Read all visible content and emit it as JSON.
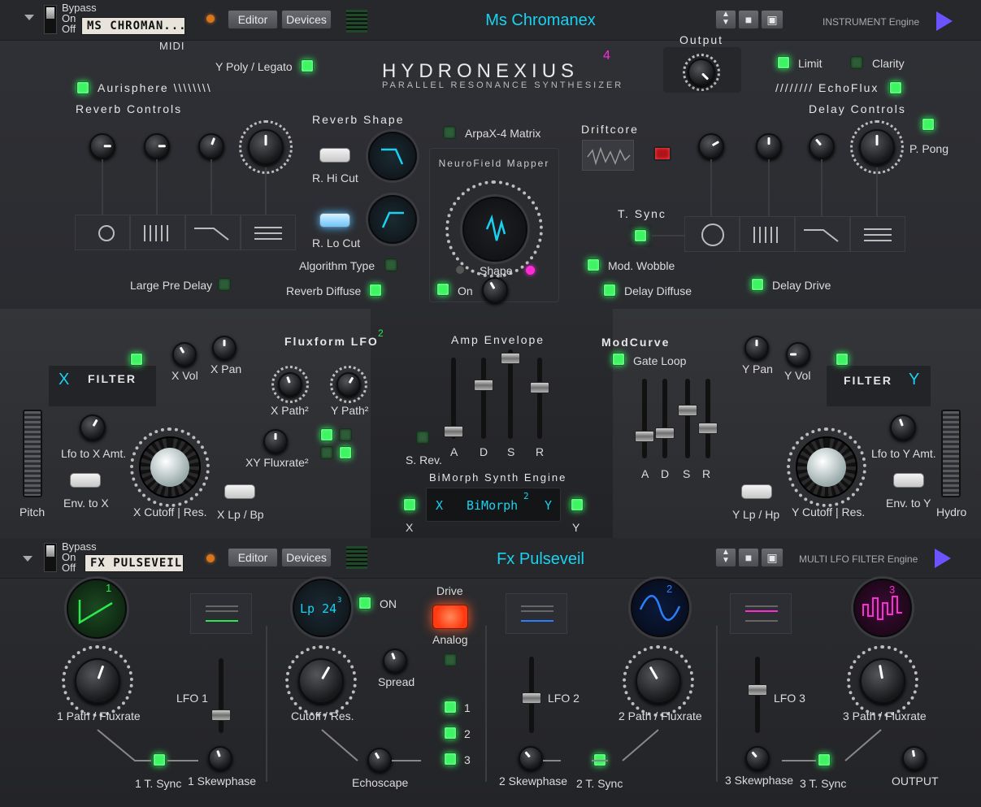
{
  "top": {
    "bypass": {
      "title": "Bypass",
      "on": "On",
      "off": "Off"
    },
    "preset_name": "MS CHROMAN...",
    "midi": "MIDI",
    "editor": "Editor",
    "devices": "Devices",
    "title": "Ms Chromanex",
    "engine": "INSTRUMENT Engine",
    "output": "Output",
    "logo": "HYDRONEXIUS",
    "logo_sup": "4",
    "subtitle": "PARALLEL RESONANCE SYNTHESIZER",
    "poly": "Y Poly / Legato",
    "limit": "Limit",
    "clarity": "Clarity",
    "aurisphere": "Aurisphere \\\\\\\\\\\\\\\\",
    "echoflux": "//////// EchoFlux",
    "reverb_controls": "Reverb Controls",
    "delay_controls": "Delay Controls",
    "reverb_shape": "Reverb Shape",
    "r_hi_cut": "R. Hi Cut",
    "r_lo_cut": "R. Lo Cut",
    "arpax": "ArpaX-4 Matrix",
    "neurofield": "NeuroField Mapper",
    "shape": "Shape",
    "on": "On",
    "driftcore": "Driftcore",
    "p_pong": "P. Pong",
    "t_sync": "T. Sync",
    "mod_wobble": "Mod. Wobble",
    "algorithm_type": "Algorithm Type",
    "large_pre_delay": "Large Pre Delay",
    "reverb_diffuse": "Reverb Diffuse",
    "delay_diffuse": "Delay Diffuse",
    "delay_drive": "Delay Drive"
  },
  "mid": {
    "x_filter": "FILTER",
    "y_filter": "FILTER",
    "x_glyph": "X",
    "y_glyph": "Y",
    "x_vol": "X Vol",
    "x_pan": "X Pan",
    "fluxform": "Fluxform LFO",
    "fluxform_sup": "2",
    "x_path": "X Path²",
    "y_path": "Y Path²",
    "xy_fluxrate": "XY Fluxrate²",
    "lfo_x": "Lfo to X Amt.",
    "env_x": "Env. to X",
    "x_cutoff": "X Cutoff | Res.",
    "x_lp_bp": "X Lp / Bp",
    "pitch": "Pitch",
    "amp_env": "Amp Envelope",
    "s_rev": "S. Rev.",
    "adsr": [
      "A",
      "D",
      "S",
      "R"
    ],
    "bimorph_engine": "BiMorph Synth Engine",
    "bimorph": "BiMorph",
    "bimorph_sup": "2",
    "x": "X",
    "y": "Y",
    "modcurve": "ModCurve",
    "gate_loop": "Gate Loop",
    "y_pan": "Y Pan",
    "y_vol": "Y Vol",
    "lfo_y": "Lfo to Y Amt.",
    "env_y": "Env. to Y",
    "y_cutoff": "Y Cutoff | Res.",
    "y_lp_hp": "Y Lp / Hp",
    "hydro": "Hydro"
  },
  "bot": {
    "bypass": {
      "title": "Bypass",
      "on": "On",
      "off": "Off"
    },
    "preset_name": "FX PULSEVEIL",
    "editor": "Editor",
    "devices": "Devices",
    "title": "Fx Pulseveil",
    "engine": "MULTI  LFO FILTER Engine",
    "lfo1_num": "1",
    "lfo2_num": "2",
    "lfo3_num": "3",
    "path1": "1 Path / Fluxrate",
    "path2": "2 Path / Fluxrate",
    "path3": "3 Path / Fluxrate",
    "lfo1": "LFO 1",
    "lfo2": "LFO 2",
    "lfo3": "LFO 3",
    "tsync1": "1 T. Sync",
    "tsync2": "2 T. Sync",
    "tsync3": "3 T. Sync",
    "skew1": "1 Skewphase",
    "skew2": "2 Skewphase",
    "skew3": "3 Skewphase",
    "filter_disp": "Lp 24",
    "filter_sup": "3",
    "on": "ON",
    "spread": "Spread",
    "cutoff": "Cutoff / Res.",
    "echoscape": "Echoscape",
    "drive": "Drive",
    "analog": "Analog",
    "sel": [
      "1",
      "2",
      "3"
    ],
    "output": "OUTPUT"
  },
  "colors": {
    "led": "#3df562",
    "cyan": "#19d2f0",
    "magenta": "#ff2bd6",
    "green": "#2ee84f",
    "blue": "#2a7fff",
    "drive": "#ff5a2a"
  }
}
